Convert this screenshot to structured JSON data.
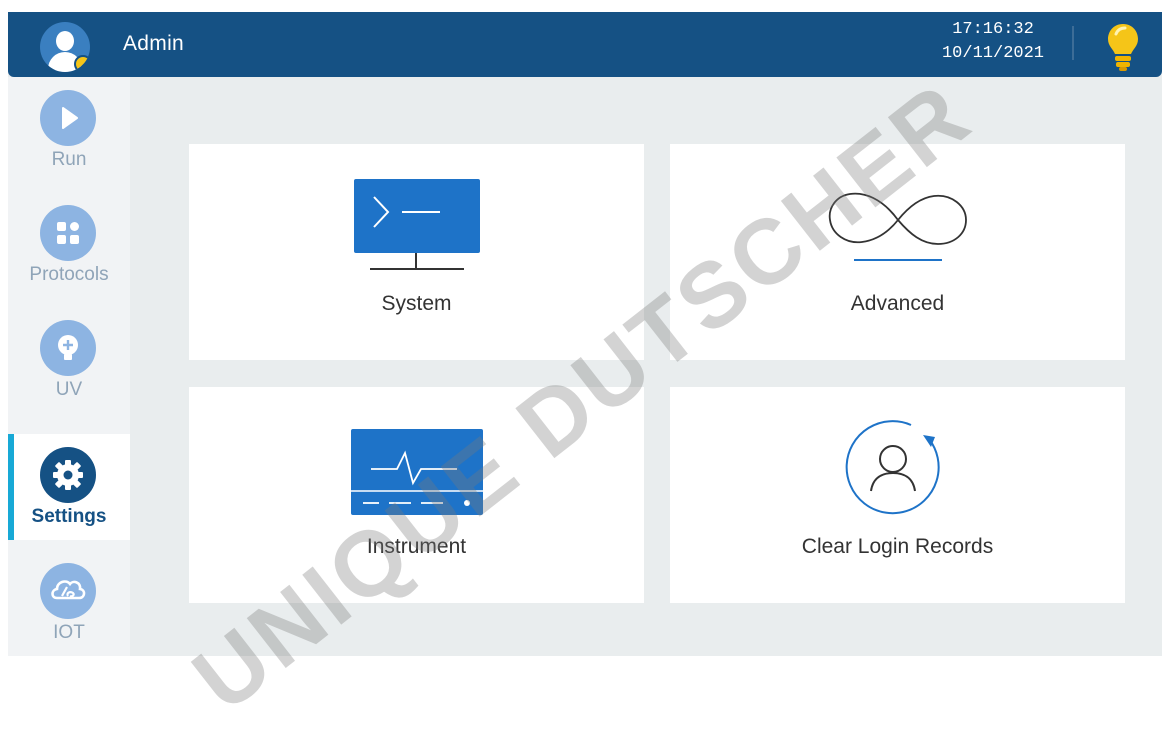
{
  "header": {
    "user_name": "Admin",
    "time": "17:16:32",
    "date": "10/11/2021",
    "avatar_icon": "user-avatar-icon",
    "bulb_icon": "lightbulb-icon",
    "bulb_color": "#f5c518"
  },
  "sidebar": {
    "items": [
      {
        "label": "Run",
        "icon": "play-icon",
        "active": false
      },
      {
        "label": "Protocols",
        "icon": "grid-icon",
        "active": false
      },
      {
        "label": "UV",
        "icon": "uv-bulb-icon",
        "active": false
      },
      {
        "label": "Settings",
        "icon": "gear-icon",
        "active": true
      },
      {
        "label": "IOT",
        "icon": "cloud-iot-icon",
        "active": false
      }
    ]
  },
  "cards": [
    {
      "label": "System",
      "icon": "terminal-monitor-icon"
    },
    {
      "label": "Advanced",
      "icon": "infinity-icon"
    },
    {
      "label": "Instrument",
      "icon": "instrument-waveform-icon"
    },
    {
      "label": "Clear Login Records",
      "icon": "user-reset-icon"
    }
  ],
  "watermark": "UNIQUE DUTSCHER",
  "colors": {
    "header_bg": "#155184",
    "active_accent": "#18a9d6",
    "icon_blue": "#1e73c8",
    "inactive_icon": "#8db4e2",
    "screen_bg": "#e9edee"
  }
}
